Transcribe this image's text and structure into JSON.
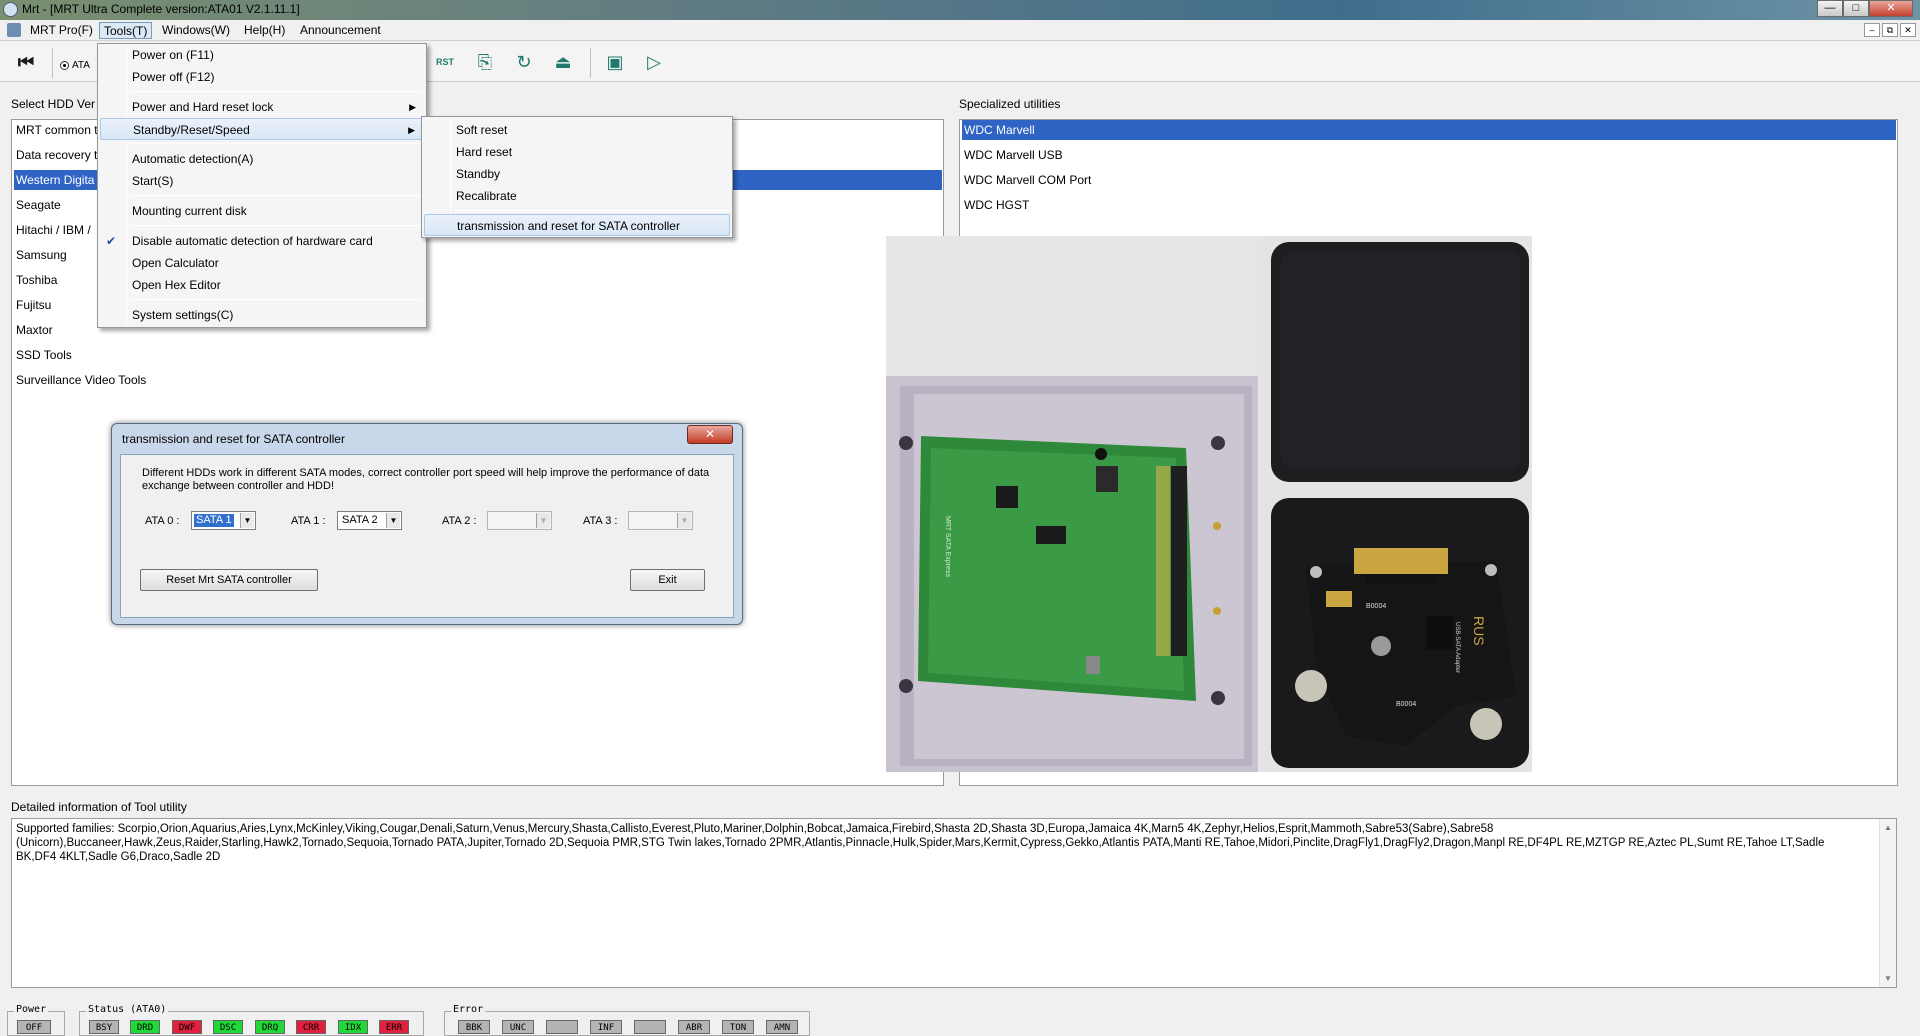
{
  "window": {
    "title": "Mrt - [MRT Ultra Complete version:ATA01 V2.1.11.1]",
    "buttons": {
      "minimize": "—",
      "maximize": "□",
      "close": "✕"
    }
  },
  "menubar": {
    "items": [
      "MRT Pro(F)",
      "Tools(T)",
      "Windows(W)",
      "Help(H)",
      "Announcement"
    ],
    "mdi_buttons": [
      "–",
      "⧉",
      "✕"
    ]
  },
  "toolbar": {
    "radio_label": "ATA",
    "icons": [
      "back-icon",
      "rst-icon",
      "card-icon",
      "refresh-icon",
      "eject-icon",
      "chip-icon",
      "export-icon"
    ],
    "rst_text": "RST"
  },
  "left_panel": {
    "label": "Select HDD Ver",
    "items": [
      "MRT common t",
      "Data recovery t",
      "Western Digita",
      "Seagate",
      "Hitachi / IBM /",
      "Samsung",
      "Toshiba",
      "Fujitsu",
      "Maxtor",
      "SSD Tools",
      "Surveillance Video Tools"
    ],
    "selected_index": 2
  },
  "right_panel": {
    "label": "Specialized utilities",
    "items": [
      "WDC Marvell",
      "WDC Marvell USB",
      "WDC Marvell COM Port",
      "WDC HGST"
    ],
    "selected_index": 0
  },
  "tools_menu": {
    "items": [
      {
        "label": "Power on (F11)"
      },
      {
        "label": "Power off (F12)"
      },
      {
        "label": "Power and Hard reset lock",
        "submenu": true
      },
      {
        "label": "Standby/Reset/Speed",
        "submenu": true,
        "highlighted": true
      },
      {
        "label": "Automatic detection(A)"
      },
      {
        "label": "Start(S)"
      },
      {
        "label": "Mounting current disk"
      },
      {
        "label": "Disable automatic detection of hardware card",
        "checked": true
      },
      {
        "label": "Open Calculator"
      },
      {
        "label": "Open Hex Editor"
      },
      {
        "label": "System settings(C)"
      }
    ]
  },
  "submenu": {
    "items": [
      "Soft reset",
      "Hard reset",
      "Standby",
      "Recalibrate",
      "transmission and reset for SATA controller"
    ],
    "highlighted_index": 4
  },
  "dialog": {
    "title": "transmission and reset for SATA controller",
    "close": "✕",
    "description": "Different HDDs work in different SATA modes, correct controller port speed will help improve the performance of data exchange between controller and HDD!",
    "ports": [
      {
        "label": "ATA 0 :",
        "value": "SATA 1",
        "enabled": true,
        "selected": true
      },
      {
        "label": "ATA 1 :",
        "value": "SATA 2",
        "enabled": true,
        "selected": false
      },
      {
        "label": "ATA 2 :",
        "value": "",
        "enabled": false,
        "selected": false
      },
      {
        "label": "ATA 3 :",
        "value": "",
        "enabled": false,
        "selected": false
      }
    ],
    "reset_button": "Reset Mrt SATA controller",
    "exit_button": "Exit"
  },
  "detail": {
    "label": "Detailed information of Tool utility",
    "text": "Supported families: Scorpio,Orion,Aquarius,Aries,Lynx,McKinley,Viking,Cougar,Denali,Saturn,Venus,Mercury,Shasta,Callisto,Everest,Pluto,Mariner,Dolphin,Bobcat,Jamaica,Firebird,Shasta 2D,Shasta 3D,Europa,Jamaica 4K,Marn5 4K,Zephyr,Helios,Esprit,Mammoth,Sabre53(Sabre),Sabre58 (Unicorn),Buccaneer,Hawk,Zeus,Raider,Starling,Hawk2,Tornado,Sequoia,Tornado PATA,Jupiter,Tornado 2D,Sequoia PMR,STG Twin lakes,Tornado 2PMR,Atlantis,Pinnacle,Hulk,Spider,Mars,Kermit,Cypress,Gekko,Atlantis PATA,Manti RE,Tahoe,Midori,Pinclite,DragFly1,DragFly2,Dragon,Manpl RE,DF4PL RE,MZTGP RE,Aztec PL,Sumt RE,Tahoe LT,Sadle BK,DF4 4KLT,Sadle G6,Draco,Sadle 2D"
  },
  "photo": {
    "board1_text": "MRT SATA Express",
    "board2_text": "RUS",
    "board2_label": "USB-SATA Adapter",
    "chip_code": "B0004",
    "chip_code2": "B0004"
  },
  "status_bar": {
    "power": {
      "label": "Power",
      "indicators": [
        {
          "text": "OFF",
          "color": "gray"
        }
      ]
    },
    "status": {
      "label": "Status (ATA0)",
      "indicators": [
        {
          "text": "BSY",
          "color": "gray"
        },
        {
          "text": "DRD",
          "color": "green"
        },
        {
          "text": "DWF",
          "color": "red"
        },
        {
          "text": "DSC",
          "color": "green"
        },
        {
          "text": "DRQ",
          "color": "green"
        },
        {
          "text": "CRR",
          "color": "red"
        },
        {
          "text": "IDX",
          "color": "green"
        },
        {
          "text": "ERR",
          "color": "red"
        }
      ]
    },
    "error": {
      "label": "Error",
      "indicators": [
        {
          "text": "BBK",
          "color": "gray"
        },
        {
          "text": "UNC",
          "color": "gray"
        },
        {
          "text": "",
          "color": "gray"
        },
        {
          "text": "INF",
          "color": "gray"
        },
        {
          "text": "",
          "color": "gray"
        },
        {
          "text": "ABR",
          "color": "gray"
        },
        {
          "text": "TON",
          "color": "gray"
        },
        {
          "text": "AMN",
          "color": "gray"
        }
      ]
    }
  },
  "colors": {
    "selection": "#2f63c4",
    "indicator_green": "#20d838",
    "indicator_red": "#e0203c",
    "indicator_gray": "#b4b4b4"
  }
}
